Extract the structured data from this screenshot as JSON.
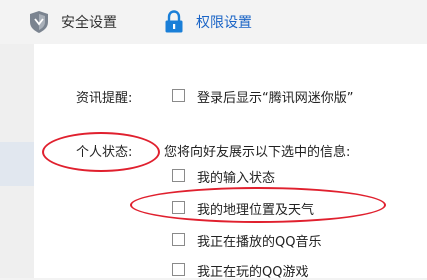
{
  "tabs": [
    {
      "label": "安全设置",
      "icon": "shield-icon"
    },
    {
      "label": "权限设置",
      "icon": "lock-icon",
      "active": true
    }
  ],
  "settings": {
    "news_label": "资讯提醒:",
    "news_option": "登录后显示“腾讯网迷你版”",
    "status_label": "个人状态:",
    "status_desc": "您将向好友展示以下选中的信息:",
    "status_options": [
      {
        "label": "我的输入状态",
        "checked": false
      },
      {
        "label": "我的地理位置及天气",
        "checked": false
      },
      {
        "label": "我正在播放的QQ音乐",
        "checked": false
      },
      {
        "label": "我正在玩的QQ游戏",
        "checked": false
      }
    ]
  },
  "colors": {
    "accent": "#1a64c6",
    "highlight_ring": "#e0202e"
  }
}
